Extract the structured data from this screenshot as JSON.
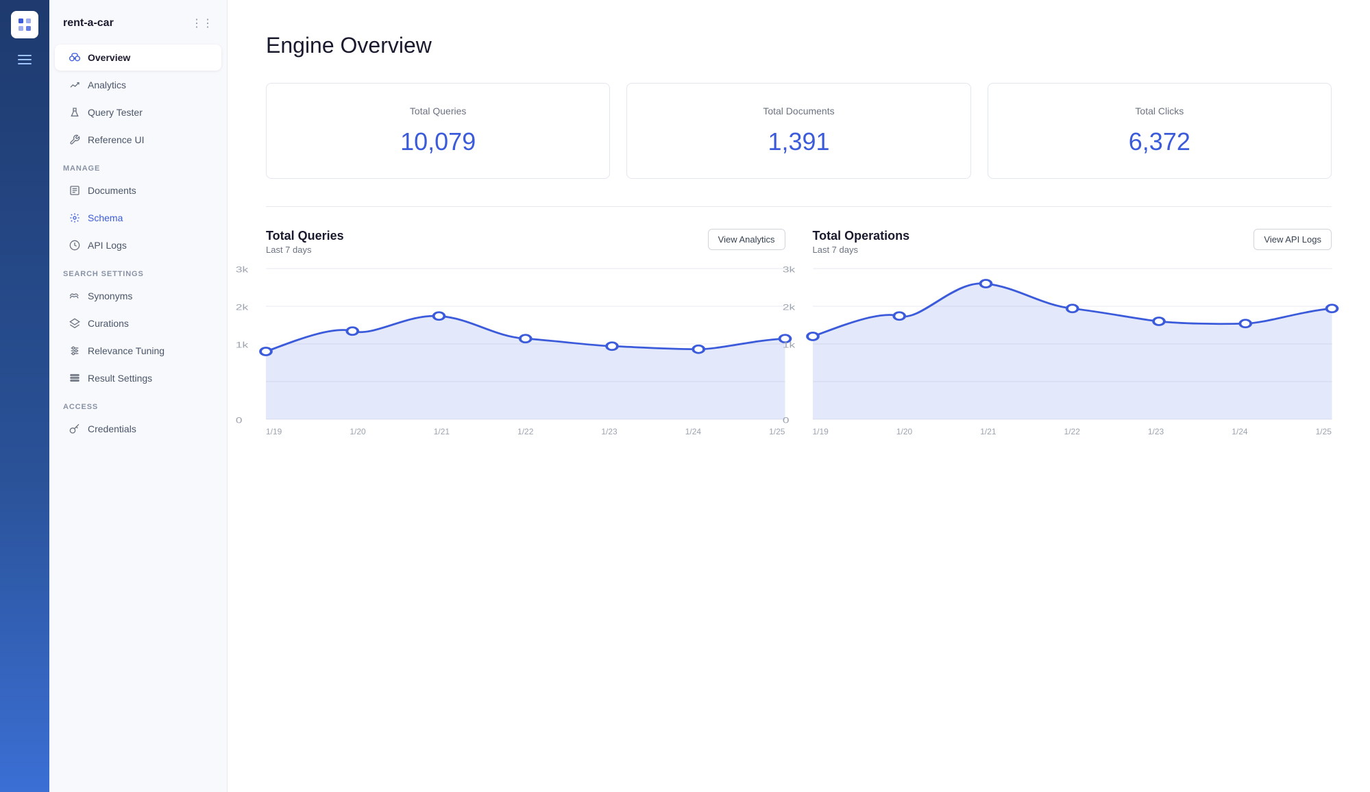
{
  "app": {
    "name": "rent-a-car"
  },
  "nav": {
    "main_items": [
      {
        "id": "overview",
        "label": "Overview",
        "active": true,
        "icon": "binoculars"
      },
      {
        "id": "analytics",
        "label": "Analytics",
        "active": false,
        "icon": "chart-up"
      },
      {
        "id": "query-tester",
        "label": "Query Tester",
        "active": false,
        "icon": "flask"
      },
      {
        "id": "reference-ui",
        "label": "Reference UI",
        "active": false,
        "icon": "wrench"
      }
    ],
    "manage_label": "MANAGE",
    "manage_items": [
      {
        "id": "documents",
        "label": "Documents",
        "icon": "docs"
      },
      {
        "id": "schema",
        "label": "Schema",
        "icon": "gear",
        "highlighted": true
      },
      {
        "id": "api-logs",
        "label": "API Logs",
        "icon": "clock"
      }
    ],
    "search_settings_label": "SEARCH SETTINGS",
    "search_items": [
      {
        "id": "synonyms",
        "label": "Synonyms",
        "icon": "wave"
      },
      {
        "id": "curations",
        "label": "Curations",
        "icon": "layers"
      },
      {
        "id": "relevance-tuning",
        "label": "Relevance Tuning",
        "icon": "sliders"
      },
      {
        "id": "result-settings",
        "label": "Result Settings",
        "icon": "list"
      }
    ],
    "access_label": "ACCESS",
    "access_items": [
      {
        "id": "credentials",
        "label": "Credentials",
        "icon": "key"
      }
    ]
  },
  "page": {
    "title": "Engine Overview"
  },
  "stats": [
    {
      "label": "Total Queries",
      "value": "10,079"
    },
    {
      "label": "Total Documents",
      "value": "1,391"
    },
    {
      "label": "Total Clicks",
      "value": "6,372"
    }
  ],
  "charts": [
    {
      "id": "total-queries",
      "title": "Total Queries",
      "subtitle": "Last 7 days",
      "button_label": "View Analytics",
      "x_labels": [
        "1/19",
        "1/20",
        "1/21",
        "1/22",
        "1/23",
        "1/24",
        "1/25"
      ],
      "y_labels": [
        "3k",
        "2k",
        "1k",
        "0"
      ],
      "data_points": [
        1350,
        1750,
        2050,
        1600,
        1450,
        1400,
        1600
      ]
    },
    {
      "id": "total-operations",
      "title": "Total Operations",
      "subtitle": "Last 7 days",
      "button_label": "View API Logs",
      "x_labels": [
        "1/19",
        "1/20",
        "1/21",
        "1/22",
        "1/23",
        "1/24",
        "1/25"
      ],
      "y_labels": [
        "3k",
        "2k",
        "1k",
        "0"
      ],
      "data_points": [
        1650,
        2050,
        2700,
        2200,
        1950,
        1900,
        2200
      ]
    }
  ],
  "colors": {
    "accent": "#3b5bdb",
    "chart_line": "#3b5bdb",
    "chart_fill": "rgba(100,130,230,0.15)"
  }
}
